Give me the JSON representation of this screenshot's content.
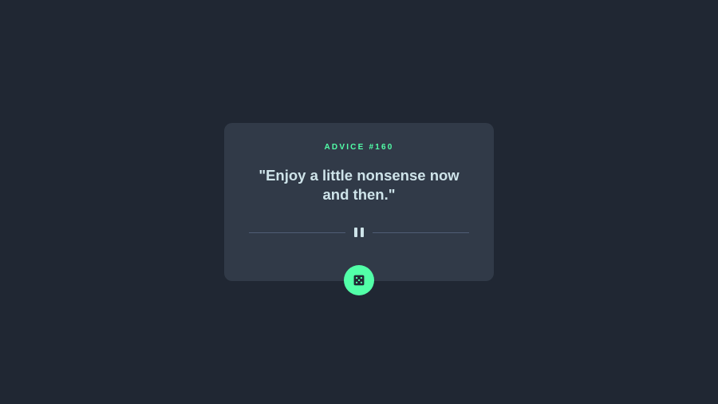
{
  "advice": {
    "id_label": "ADVICE #160",
    "quote": "\"Enjoy a little nonsense now and then.\""
  },
  "icons": {
    "divider": "pause-icon",
    "button": "dice-icon"
  },
  "colors": {
    "background": "#202733",
    "card": "#313a48",
    "accent": "#52ffa8",
    "text": "#cee3e9",
    "divider": "#4f5d74"
  }
}
